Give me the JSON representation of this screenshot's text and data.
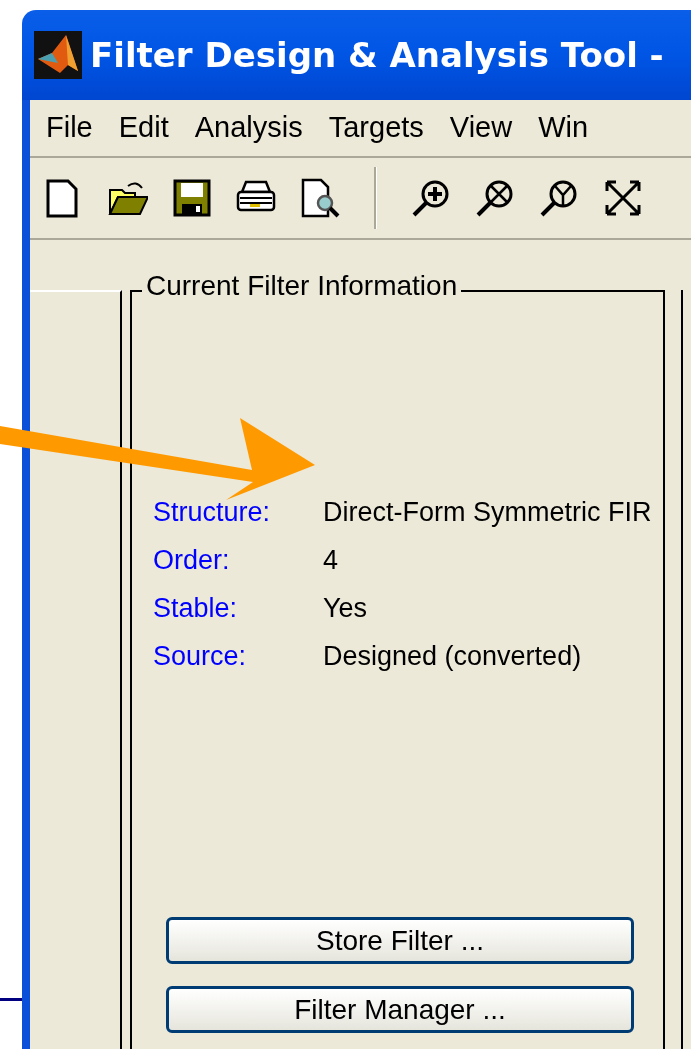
{
  "window": {
    "title": "Filter Design & Analysis Tool -"
  },
  "menu": [
    {
      "label": "File"
    },
    {
      "label": "Edit"
    },
    {
      "label": "Analysis"
    },
    {
      "label": "Targets"
    },
    {
      "label": "View"
    },
    {
      "label": "Win"
    }
  ],
  "toolbar": [
    {
      "kind": "new"
    },
    {
      "kind": "open"
    },
    {
      "kind": "save"
    },
    {
      "kind": "print"
    },
    {
      "kind": "preview"
    },
    {
      "kind": "separator"
    },
    {
      "kind": "zoom-in"
    },
    {
      "kind": "zoom-x"
    },
    {
      "kind": "zoom-y"
    },
    {
      "kind": "full-view"
    }
  ],
  "filter_info": {
    "title": "Current Filter Information",
    "rows": [
      {
        "label": "Structure:",
        "value": "Direct-Form Symmetric FIR"
      },
      {
        "label": "Order:",
        "value": "4"
      },
      {
        "label": "Stable:",
        "value": "Yes"
      },
      {
        "label": "Source:",
        "value": "Designed (converted)"
      }
    ],
    "buttons": [
      "Store Filter ...",
      "Filter Manager ..."
    ]
  }
}
